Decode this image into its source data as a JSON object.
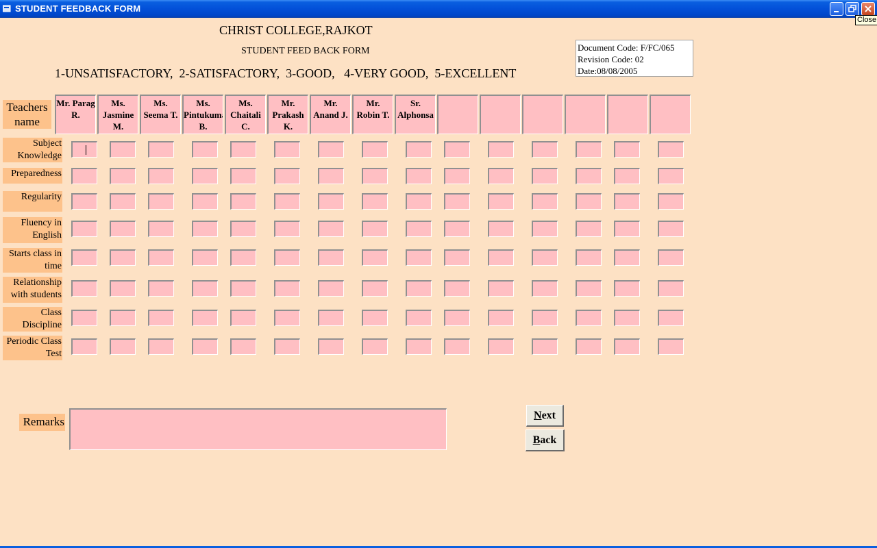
{
  "window": {
    "title": "STUDENT FEEDBACK FORM",
    "tooltip": "Close",
    "icon": "app-icon"
  },
  "header": {
    "college": "CHRIST COLLEGE,RAJKOT",
    "form_title": "STUDENT FEED BACK FORM",
    "scale": "1-UNSATISFACTORY,  2-SATISFACTORY,  3-GOOD,   4-VERY GOOD,  5-EXCELLENT"
  },
  "doc_info": {
    "document_code": "Document Code: F/FC/065",
    "revision_code": "Revision Code: 02",
    "date": "Date:08/08/2005"
  },
  "teachers_label": "Teachers name",
  "teachers": [
    "Mr. Parag R.",
    "Ms. Jasmine M.",
    "Ms. Seema T.",
    "Ms. Pintukumari B.",
    "Ms. Chaitali C.",
    "Mr. Prakash K.",
    "Mr. Anand J.",
    "Mr. Robin T.",
    "Sr. Alphonsa",
    "",
    "",
    "",
    "",
    "",
    ""
  ],
  "criteria": [
    "Subject Knowledge",
    "Preparedness",
    "Regularity",
    "Fluency in English",
    "Starts class in time",
    "Relationship with students",
    "Class Discipline",
    "Periodic Class Test"
  ],
  "remarks": {
    "label": "Remarks",
    "value": ""
  },
  "buttons": {
    "next_label": "Next",
    "back_label": "Back"
  },
  "colors": {
    "background": "#fde1c4",
    "field": "#ffbfc3",
    "label_bg": "#fdc28b",
    "titlebar": "#0350d8"
  }
}
